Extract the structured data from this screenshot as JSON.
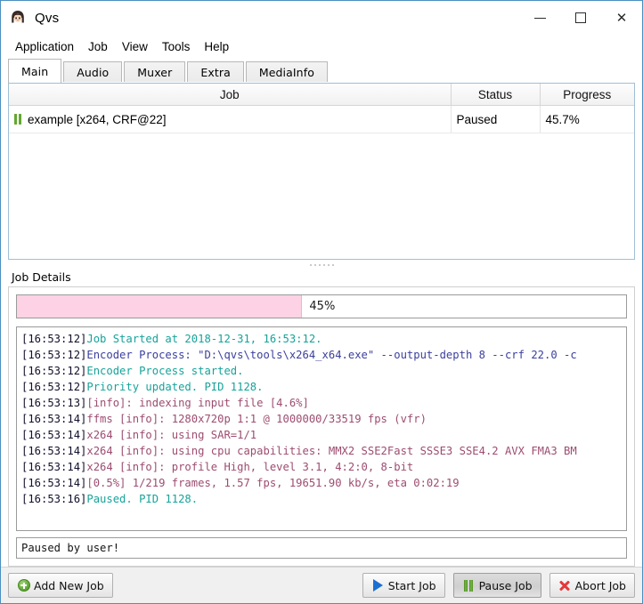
{
  "window": {
    "title": "Qvs",
    "app_icon": "anime-face-icon",
    "controls": {
      "minimize": "minimize-icon",
      "maximize": "maximize-icon",
      "close": "close-icon"
    }
  },
  "menubar": {
    "items": [
      {
        "label": "Application"
      },
      {
        "label": "Job"
      },
      {
        "label": "View"
      },
      {
        "label": "Tools"
      },
      {
        "label": "Help"
      }
    ]
  },
  "tabs": {
    "active": "Main",
    "items": [
      {
        "label": "Main"
      },
      {
        "label": "Audio"
      },
      {
        "label": "Muxer"
      },
      {
        "label": "Extra"
      },
      {
        "label": "MediaInfo"
      }
    ]
  },
  "job_table": {
    "columns": [
      "Job",
      "Status",
      "Progress"
    ],
    "rows": [
      {
        "icon": "pause-icon",
        "job": "example [x264, CRF@22]",
        "status": "Paused",
        "progress": "45.7%"
      }
    ]
  },
  "details": {
    "group_label": "Job Details",
    "progress": {
      "percent_label": "45%",
      "percent_value": 46.6,
      "fill_color": "#fcd2e4"
    },
    "log_lines": [
      {
        "time": "[16:53:12]",
        "text": "Job Started at 2018-12-31, 16:53:12.",
        "color": "teal"
      },
      {
        "time": "[16:53:12]",
        "text": "Encoder Process: \"D:\\qvs\\tools\\x264_x64.exe\" --output-depth 8 --crf 22.0 -c",
        "color": "blue"
      },
      {
        "time": "[16:53:12]",
        "text": "Encoder Process started.",
        "color": "teal"
      },
      {
        "time": "[16:53:12]",
        "text": "Priority updated. PID 1128.",
        "color": "teal"
      },
      {
        "time": "[16:53:13]",
        "text": "[info]: indexing input file [4.6%]",
        "color": "mauve"
      },
      {
        "time": "[16:53:14]",
        "text": "ffms [info]: 1280x720p 1:1 @ 1000000/33519 fps (vfr)",
        "color": "mauve"
      },
      {
        "time": "[16:53:14]",
        "text": "x264 [info]: using SAR=1/1",
        "color": "mauve"
      },
      {
        "time": "[16:53:14]",
        "text": "x264 [info]: using cpu capabilities: MMX2 SSE2Fast SSSE3 SSE4.2 AVX FMA3 BM",
        "color": "mauve"
      },
      {
        "time": "[16:53:14]",
        "text": "x264 [info]: profile High, level 3.1, 4:2:0, 8-bit",
        "color": "mauve"
      },
      {
        "time": "[16:53:14]",
        "text": "[0.5%] 1/219 frames, 1.57 fps, 19651.90 kb/s, eta 0:02:19",
        "color": "mauve"
      },
      {
        "time": "[16:53:16]",
        "text": "Paused. PID 1128.",
        "color": "teal"
      }
    ],
    "status_message": "Paused by user!"
  },
  "toolbar": {
    "add_new_job": "Add New Job",
    "start_job": "Start Job",
    "pause_job": "Pause Job",
    "abort_job": "Abort Job"
  },
  "colors": {
    "accent_border": "#4a90bf",
    "progress_pink": "#fcd2e4",
    "log_teal": "#16a39a",
    "log_blue": "#3b3f9e",
    "log_mauve": "#9d4c70",
    "icon_green": "#62a830",
    "icon_blue": "#1a6fd4",
    "icon_red": "#e03a3a"
  }
}
